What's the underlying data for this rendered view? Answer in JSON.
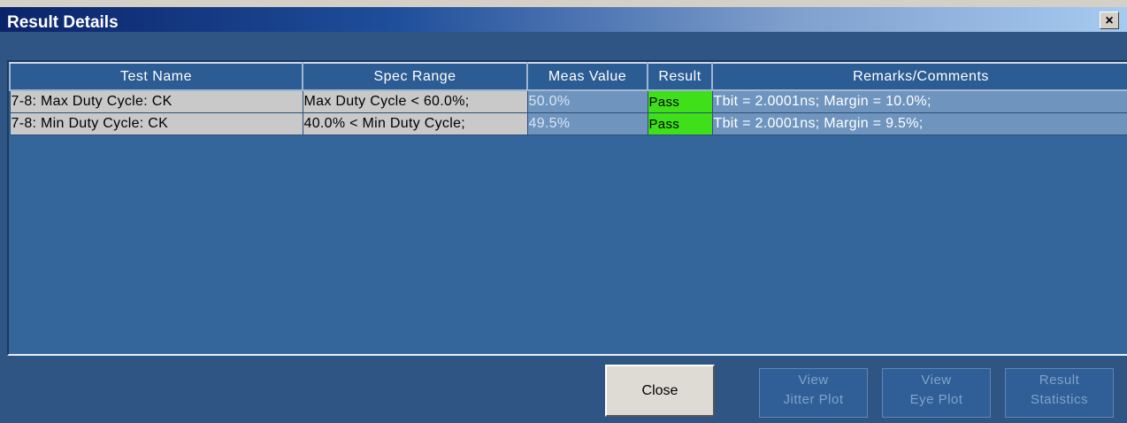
{
  "window": {
    "title": "Result Details",
    "close_glyph": "×"
  },
  "table": {
    "headers": [
      "Test Name",
      "Spec Range",
      "Meas Value",
      "Result",
      "Remarks/Comments"
    ],
    "rows": [
      {
        "test_name": "7-8: Max Duty Cycle: CK",
        "spec_range": "Max Duty Cycle < 60.0%;",
        "meas_value": "50.0%",
        "result": "Pass",
        "remarks": "Tbit = 2.0001ns; Margin = 10.0%;"
      },
      {
        "test_name": "7-8: Min Duty Cycle: CK",
        "spec_range": "40.0% < Min Duty Cycle;",
        "meas_value": "49.5%",
        "result": "Pass",
        "remarks": "Tbit = 2.0001ns; Margin = 9.5%;"
      }
    ]
  },
  "buttons": {
    "close": "Close",
    "view_jitter_line1": "View",
    "view_jitter_line2": "Jitter Plot",
    "view_eye_line1": "View",
    "view_eye_line2": "Eye Plot",
    "result_stats_line1": "Result",
    "result_stats_line2": "Statistics"
  },
  "colors": {
    "pass": "#3fe019",
    "background": "#2f5585",
    "title_bar": "#0a246a"
  }
}
